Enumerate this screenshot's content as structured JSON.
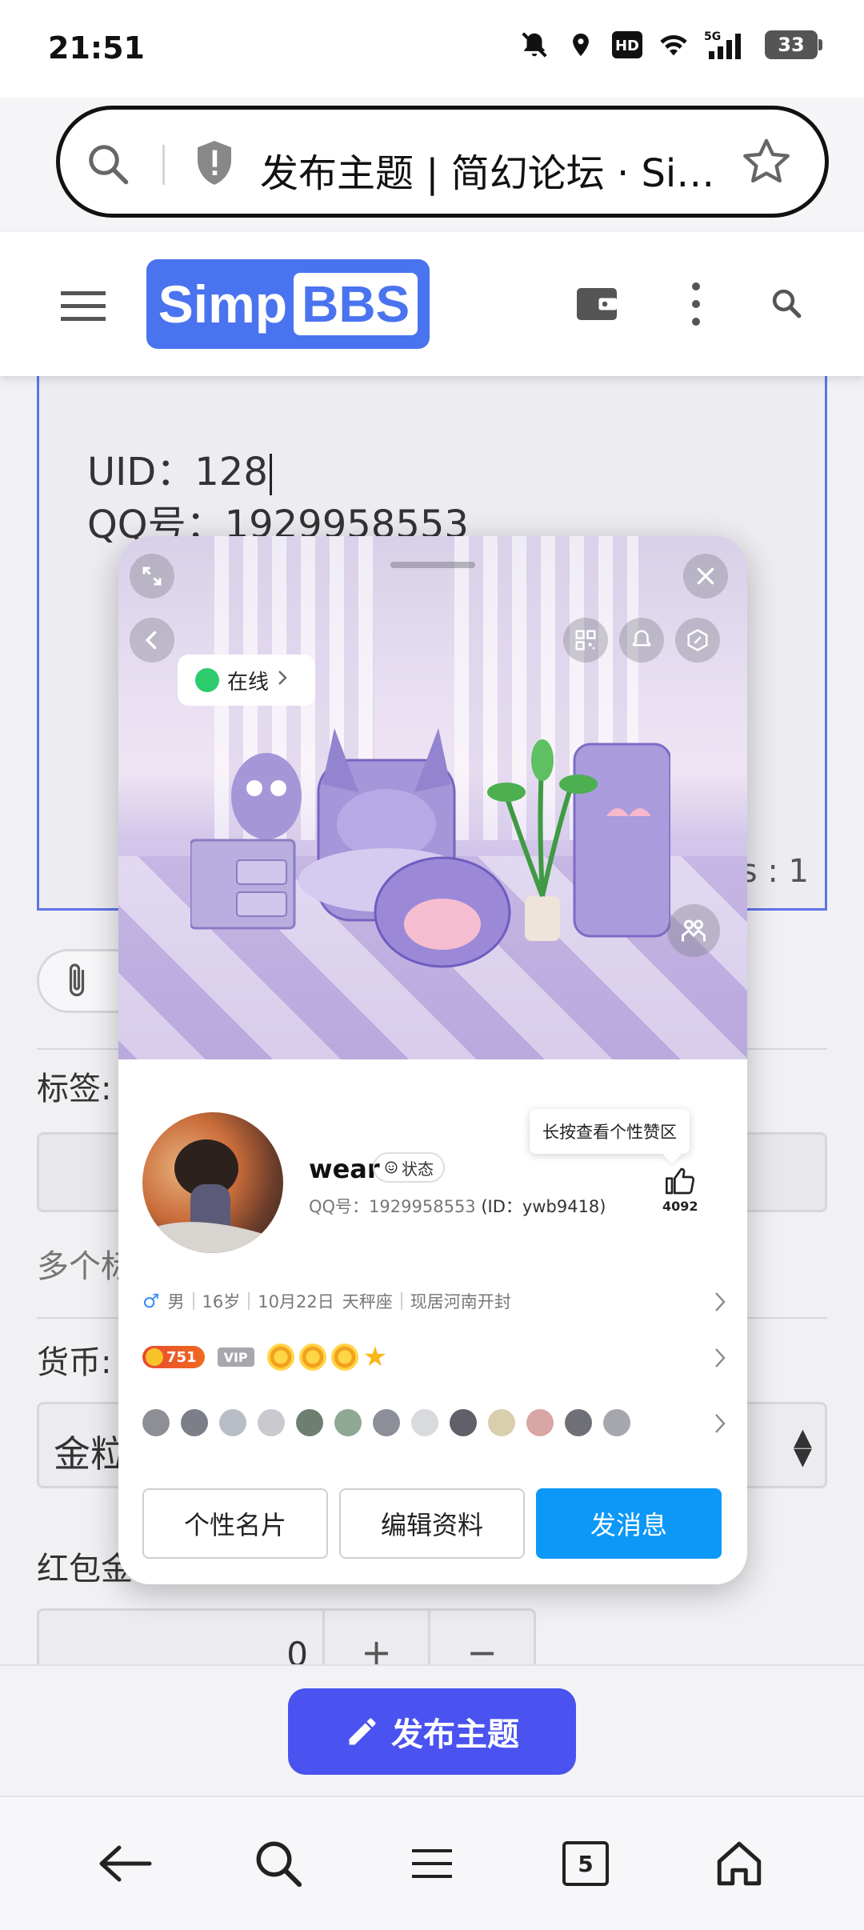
{
  "status_bar": {
    "time": "21:51",
    "battery": "33",
    "network": "5G",
    "hd": "HD"
  },
  "browser": {
    "url_title": "发布主题 | 简幻论坛 · Si…"
  },
  "site": {
    "logo_left": "Simp",
    "logo_right": "BBS"
  },
  "editor": {
    "uid_line": "UID：128",
    "qq_line": "QQ号：1929958553",
    "words_count": "ds : 1"
  },
  "form": {
    "tag_label": "标签:",
    "tag_hint": "多个标",
    "currency_label": "货币:",
    "currency_value": "金粒",
    "red_label": "红包金",
    "amount_value": "0",
    "plus": "+",
    "minus": "−"
  },
  "publish": {
    "label": "发布主题"
  },
  "bottom_nav": {
    "tab_count": "5"
  },
  "popup": {
    "online_status": "在线",
    "nickname": "wear",
    "state_label": "状态",
    "qq_label": "QQ号：1929958553",
    "id_label": "(ID：ywb9418)",
    "tooltip": "长按查看个性赞区",
    "like_count": "4092",
    "info": {
      "gender": "男",
      "age": "16岁",
      "birthday": "10月22日",
      "zodiac": "天秤座",
      "location": "现居河南开封"
    },
    "level": "751",
    "vip": "VIP",
    "buttons": {
      "card": "个性名片",
      "edit": "编辑资料",
      "message": "发消息"
    }
  },
  "colors": {
    "accent": "#4a73ef",
    "publish": "#4a52f0",
    "message_btn": "#0d98f7",
    "online": "#2ccb6b"
  }
}
